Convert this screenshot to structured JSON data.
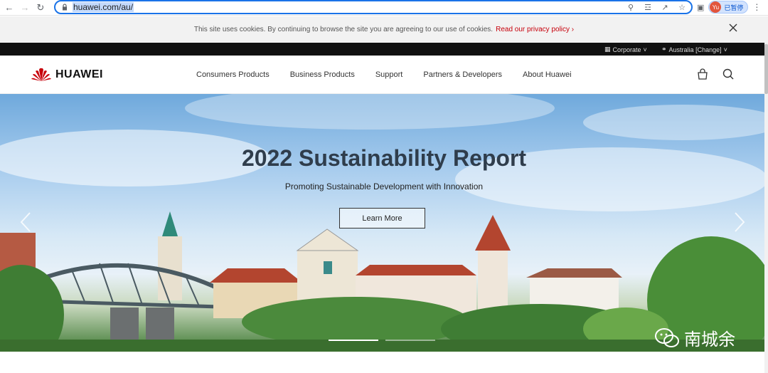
{
  "browser": {
    "url": "huawei.com/au/",
    "profile_initials": "Yu",
    "profile_status": "已暂停"
  },
  "cookie_bar": {
    "message": "This site uses cookies. By continuing to browse the site you are agreeing to our use of cookies.",
    "link": "Read our privacy policy"
  },
  "utility_bar": {
    "corporate": "Corporate",
    "region": "Australia [Change]"
  },
  "header": {
    "logo": "HUAWEI",
    "menu": [
      "Consumers Products",
      "Business Products",
      "Support",
      "Partners & Developers",
      "About Huawei"
    ]
  },
  "hero": {
    "title": "2022 Sustainability Report",
    "subtitle": "Promoting Sustainable Development with Innovation",
    "cta": "Learn More",
    "slide_count": 2,
    "active_slide": 1
  },
  "watermark": {
    "text": "南城余"
  },
  "colors": {
    "brand_red": "#c7000b",
    "url_highlight": "#c3d9fb",
    "omnibox_border": "#1a73e8"
  }
}
